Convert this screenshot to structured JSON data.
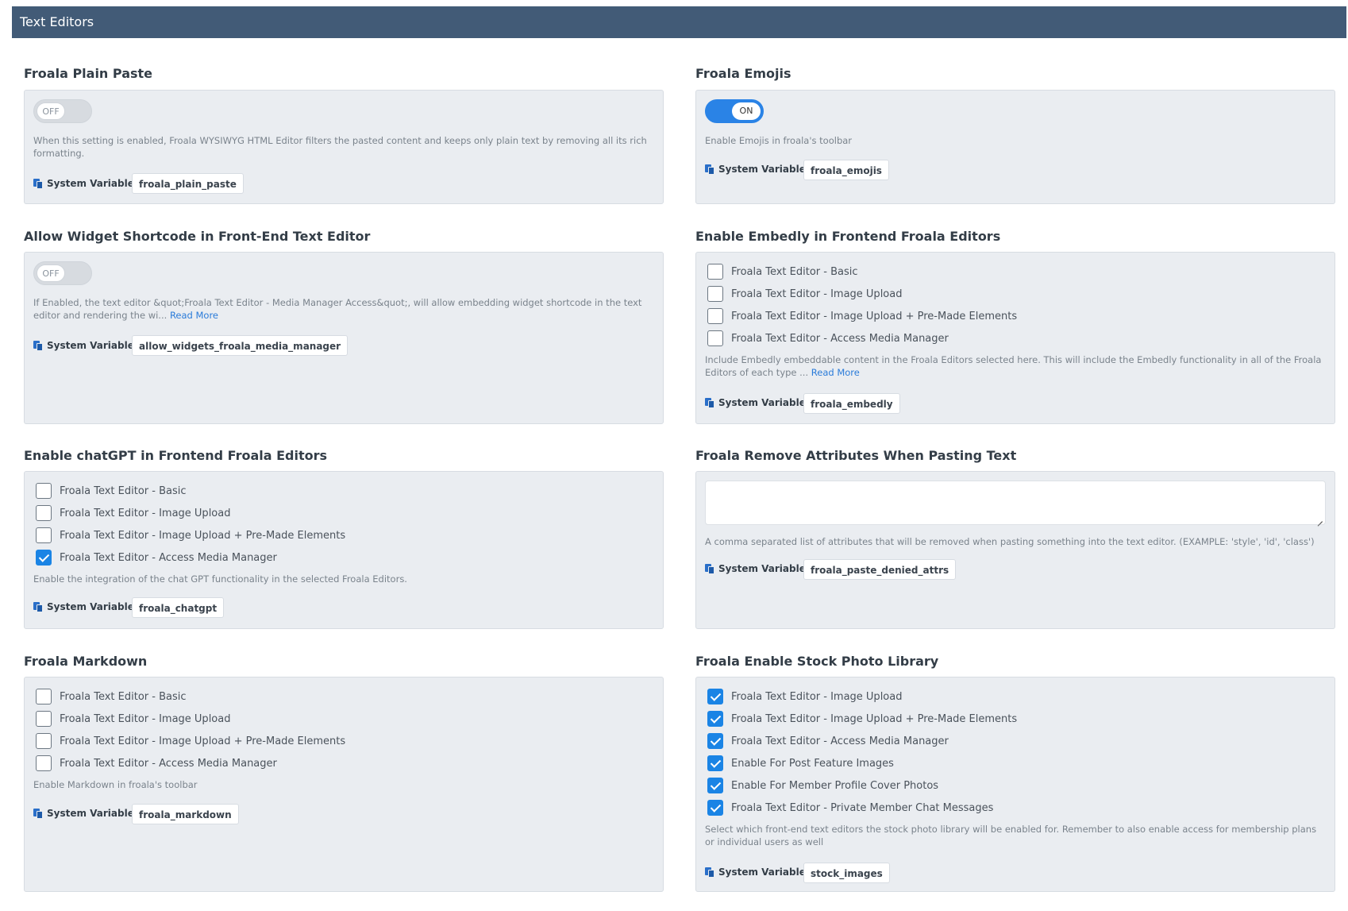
{
  "header": {
    "title": "Text Editors"
  },
  "sys_label": "System Variable",
  "read_more": "Read More",
  "plain_paste": {
    "title": "Froala Plain Paste",
    "toggle": "OFF",
    "desc": "When this setting is enabled, Froala WYSIWYG HTML Editor filters the pasted content and keeps only plain text by removing all its rich formatting.",
    "var": "froala_plain_paste"
  },
  "emojis": {
    "title": "Froala Emojis",
    "toggle": "ON",
    "desc": "Enable Emojis in froala's toolbar",
    "var": "froala_emojis"
  },
  "widget": {
    "title": "Allow Widget Shortcode in Front-End Text Editor",
    "toggle": "OFF",
    "desc": "If Enabled, the text editor &quot;Froala Text Editor - Media Manager Access&quot;, will allow embedding widget shortcode in the text editor and rendering the wi...",
    "var": "allow_widgets_froala_media_manager"
  },
  "embedly": {
    "title": "Enable Embedly in Frontend Froala Editors",
    "options": [
      {
        "label": "Froala Text Editor - Basic",
        "checked": false
      },
      {
        "label": "Froala Text Editor - Image Upload",
        "checked": false
      },
      {
        "label": "Froala Text Editor - Image Upload + Pre-Made Elements",
        "checked": false
      },
      {
        "label": "Froala Text Editor - Access Media Manager",
        "checked": false
      }
    ],
    "desc": "Include Embedly embeddable content in the Froala Editors selected here.  This will include the Embedly functionality in all of the Froala Editors of each type ...",
    "var": "froala_embedly"
  },
  "chatgpt": {
    "title": "Enable chatGPT in Frontend Froala Editors",
    "options": [
      {
        "label": "Froala Text Editor - Basic",
        "checked": false
      },
      {
        "label": "Froala Text Editor - Image Upload",
        "checked": false
      },
      {
        "label": "Froala Text Editor - Image Upload + Pre-Made Elements",
        "checked": false
      },
      {
        "label": "Froala Text Editor - Access Media Manager",
        "checked": true
      }
    ],
    "desc": "Enable the integration of the chat GPT functionality in the selected Froala Editors.",
    "var": "froala_chatgpt"
  },
  "remove_attrs": {
    "title": "Froala Remove Attributes When Pasting Text",
    "value": "",
    "desc": "A comma separated list of attributes that will be removed when pasting something into the text editor. (EXAMPLE: 'style', 'id', 'class')",
    "var": "froala_paste_denied_attrs"
  },
  "markdown": {
    "title": "Froala Markdown",
    "options": [
      {
        "label": "Froala Text Editor - Basic",
        "checked": false
      },
      {
        "label": "Froala Text Editor - Image Upload",
        "checked": false
      },
      {
        "label": "Froala Text Editor - Image Upload + Pre-Made Elements",
        "checked": false
      },
      {
        "label": "Froala Text Editor - Access Media Manager",
        "checked": false
      }
    ],
    "desc": "Enable Markdown in froala's toolbar",
    "var": "froala_markdown"
  },
  "stock": {
    "title": "Froala Enable Stock Photo Library",
    "options": [
      {
        "label": "Froala Text Editor - Image Upload",
        "checked": true
      },
      {
        "label": "Froala Text Editor - Image Upload + Pre-Made Elements",
        "checked": true
      },
      {
        "label": "Froala Text Editor - Access Media Manager",
        "checked": true
      },
      {
        "label": "Enable For Post Feature Images",
        "checked": true
      },
      {
        "label": "Enable For Member Profile Cover Photos",
        "checked": true
      },
      {
        "label": "Froala Text Editor - Private Member Chat Messages",
        "checked": true
      }
    ],
    "desc": "Select which front-end text editors the stock photo library will be enabled for. Remember to also enable access for membership plans or individual users as well",
    "var": "stock_images"
  }
}
